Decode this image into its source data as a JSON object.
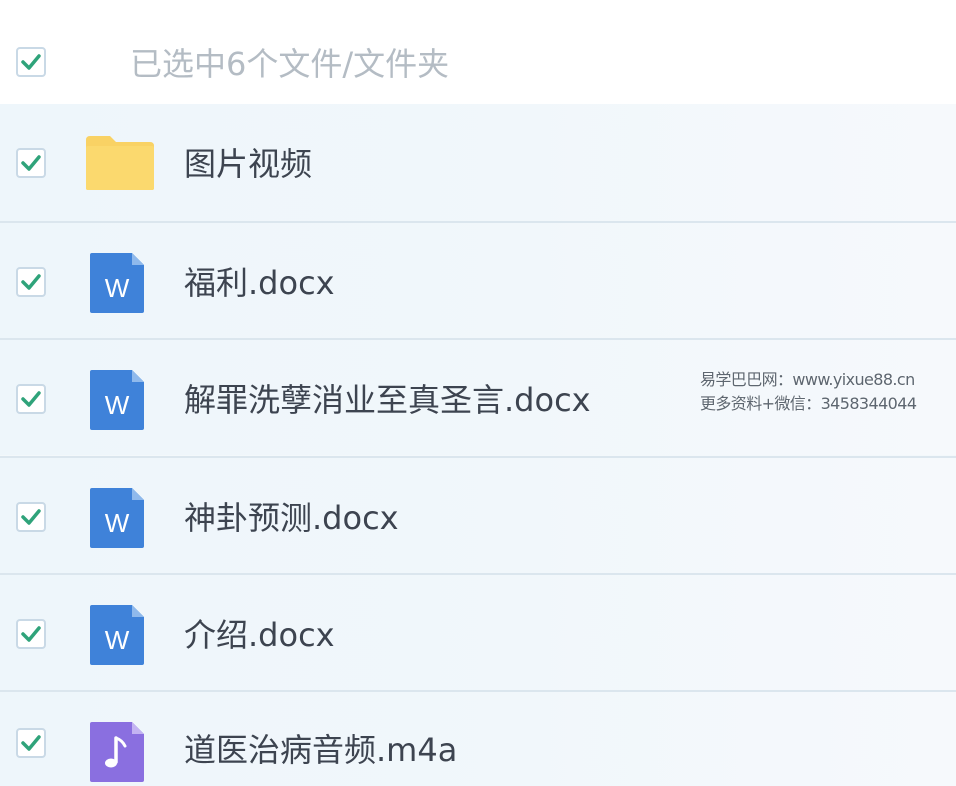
{
  "header": {
    "selection_text": "已选中6个文件/文件夹",
    "checked": true
  },
  "files": [
    {
      "name": "图片视频",
      "type": "folder",
      "icon": "folder-icon",
      "checked": true,
      "icon_color": "#f9d264"
    },
    {
      "name": "福利.docx",
      "type": "docx",
      "icon": "word-doc-icon",
      "icon_letter": "W",
      "checked": true,
      "icon_color": "#3f82d9"
    },
    {
      "name": "解罪洗孽消业至真圣言.docx",
      "type": "docx",
      "icon": "word-doc-icon",
      "icon_letter": "W",
      "checked": true,
      "icon_color": "#3f82d9"
    },
    {
      "name": "神卦预测.docx",
      "type": "docx",
      "icon": "word-doc-icon",
      "icon_letter": "W",
      "checked": true,
      "icon_color": "#3f82d9"
    },
    {
      "name": "介绍.docx",
      "type": "docx",
      "icon": "word-doc-icon",
      "icon_letter": "W",
      "checked": true,
      "icon_color": "#3f82d9"
    },
    {
      "name": "道医治病音频.m4a",
      "type": "audio",
      "icon": "music-note-icon",
      "checked": true,
      "icon_color": "#8a6fe0"
    }
  ],
  "watermark": {
    "line1": "易学巴巴网：www.yixue88.cn",
    "line2": "更多资料+微信：3458344044"
  },
  "colors": {
    "checkmark": "#2fa37a",
    "checkbox_border": "#c9d9e6",
    "row_background": "#eef6fb",
    "row_divider": "#dbe6ee"
  }
}
